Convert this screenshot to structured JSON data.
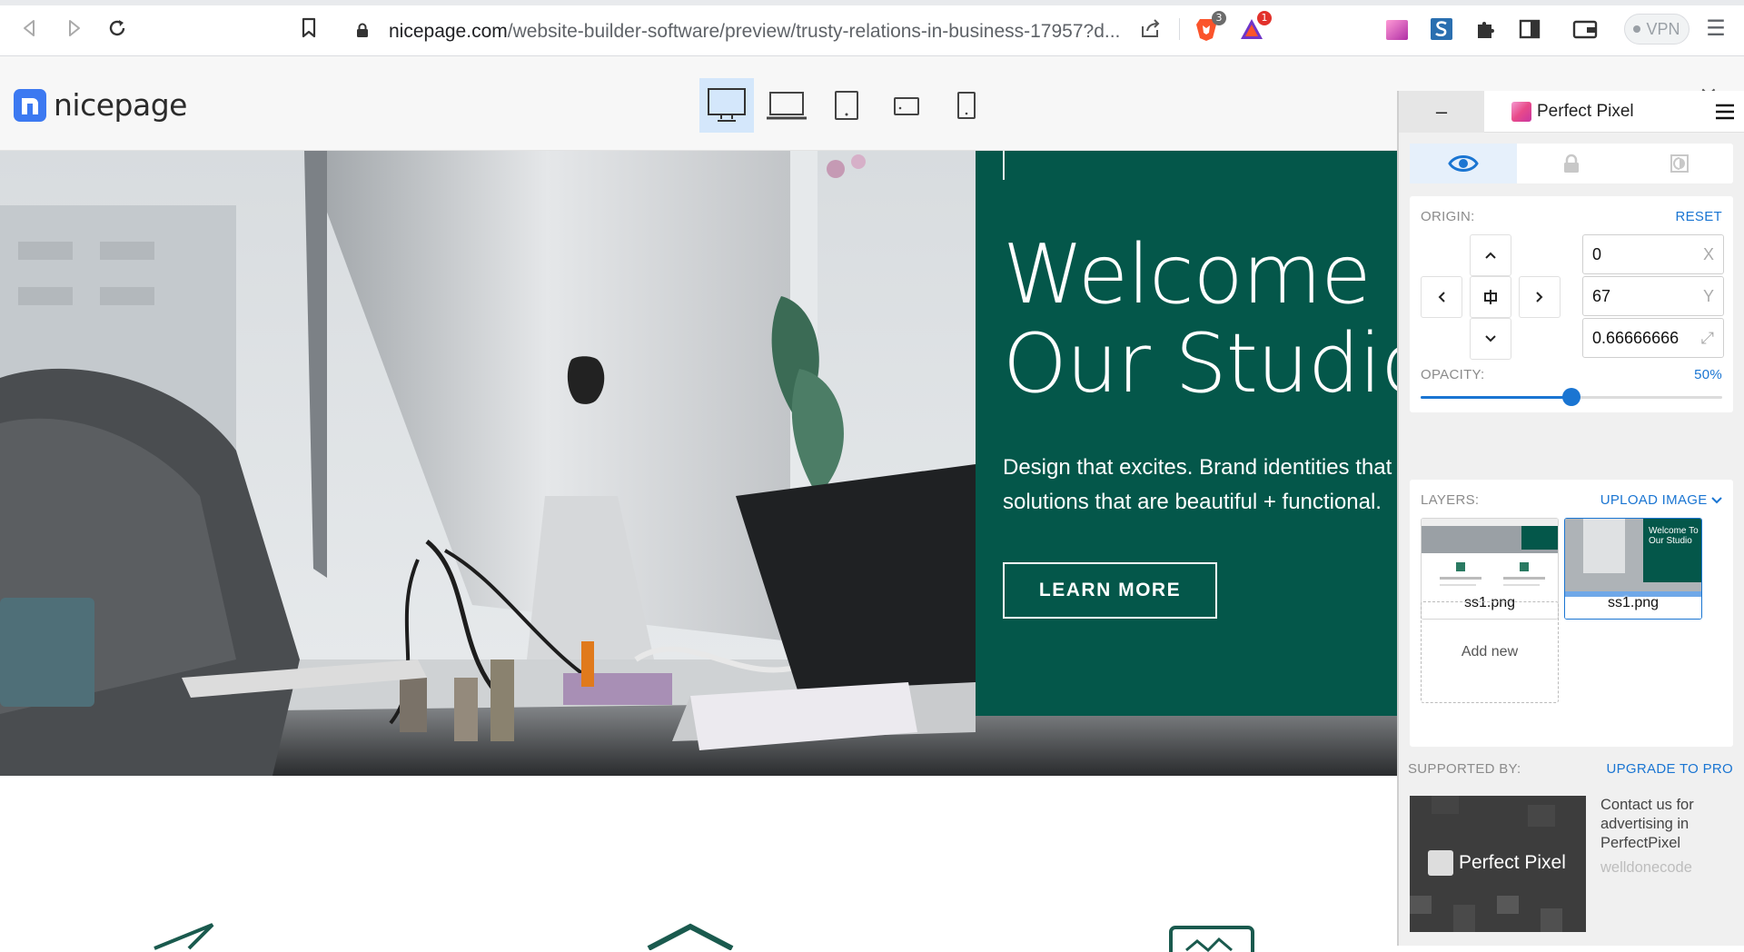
{
  "browser": {
    "url_host": "nicepage.com",
    "url_path": "/website-builder-software/preview/trusty-relations-in-business-17957?d...",
    "brave_badge": "3",
    "rewards_badge": "1",
    "vpn_label": "VPN"
  },
  "preview": {
    "logo_text": "nicepage",
    "devices": [
      "desktop-icon",
      "laptop-icon",
      "tablet-icon",
      "tablet-landscape-icon",
      "phone-icon"
    ],
    "active_device": "desktop"
  },
  "hero": {
    "title": "Welcome To\nOur Studio",
    "subtitle": "Design that excites. Brand identities that\nsolutions that are beautiful + functional.",
    "button": "LEARN MORE",
    "panel_color": "#04574a"
  },
  "perfect_pixel": {
    "title": "Perfect Pixel",
    "minimize": "–",
    "origin_label": "ORIGIN:",
    "reset": "RESET",
    "x_value": "0",
    "x_unit": "X",
    "y_value": "67",
    "y_unit": "Y",
    "scale_value": "0.66666666",
    "opacity_label": "OPACITY:",
    "opacity_text": "50%",
    "opacity_fraction": 0.5,
    "layers_label": "LAYERS:",
    "upload_image": "UPLOAD IMAGE",
    "layers": [
      {
        "name": "ss1.png",
        "active": false
      },
      {
        "name": "ss1.png",
        "active": true
      }
    ],
    "add_new": "Add new",
    "supported_by": "SUPPORTED BY:",
    "upgrade": "UPGRADE TO PRO",
    "ad_title": "Perfect Pixel",
    "ad_contact": "Contact us for advertising in PerfectPixel",
    "ad_brand": "welldonecode",
    "accent": "#1a75d2"
  },
  "thumb_text": {
    "welcome": "Welcome To\nOur Studio"
  }
}
